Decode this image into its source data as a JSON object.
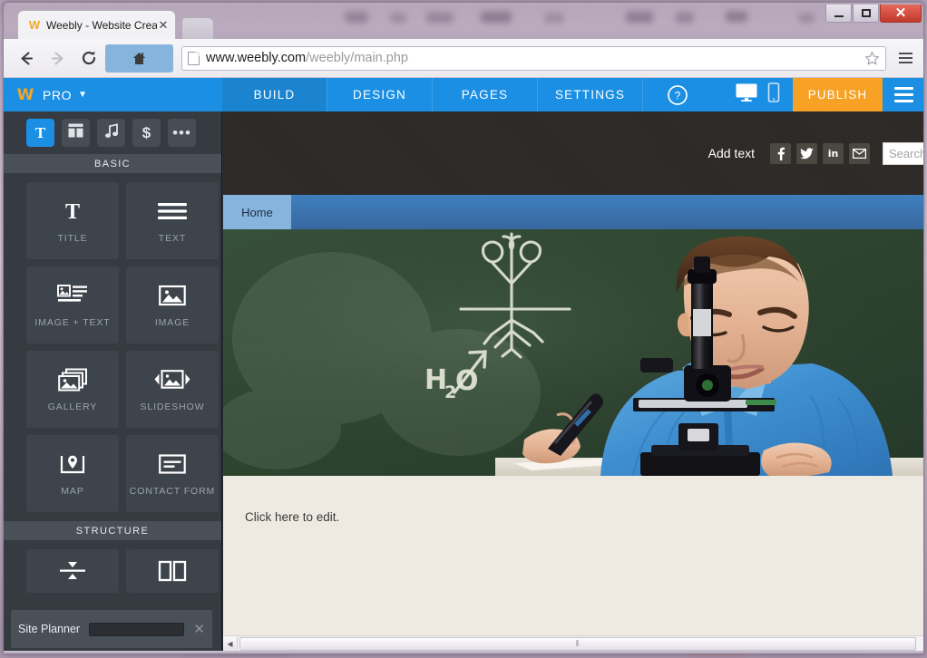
{
  "window": {
    "minimize_label": "Minimize",
    "maximize_label": "Maximize",
    "close_label": "✕"
  },
  "browser": {
    "tab": {
      "favicon": "weebly-w-icon",
      "title": "Weebly - Website Creation",
      "close_label": "✕"
    },
    "new_tab_label": "",
    "toolbar": {
      "back_label": "Back",
      "forward_label": "Forward",
      "reload_label": "Reload",
      "home_label": "Home",
      "url_prefix": "www.weebly.com",
      "url_suffix": "/weebly/main.php",
      "url_full": "www.weebly.com/weebly/main.php",
      "bookmark_label": "Bookmark",
      "menu_label": "Menu"
    }
  },
  "app": {
    "brand": {
      "logo_letter": "W",
      "plan_label": "PRO",
      "caret": "▼"
    },
    "topnav": [
      {
        "label": "BUILD",
        "active": true
      },
      {
        "label": "DESIGN",
        "active": false
      },
      {
        "label": "PAGES",
        "active": false
      },
      {
        "label": "SETTINGS",
        "active": false
      }
    ],
    "help_label": "?",
    "device_desktop_label": "Desktop preview",
    "device_mobile_label": "Mobile preview",
    "publish_label": "PUBLISH",
    "hamburger_label": "More options",
    "accent_blue": "#1b8fe3",
    "publish_orange": "#f7a125"
  },
  "sidebar": {
    "categories": [
      {
        "name": "text-elements",
        "glyph": "T",
        "active": true
      },
      {
        "name": "layout-elements",
        "glyph": "grid",
        "active": false
      },
      {
        "name": "media-elements",
        "glyph": "♪",
        "active": false
      },
      {
        "name": "commerce-elements",
        "glyph": "$",
        "active": false
      },
      {
        "name": "more-elements",
        "glyph": "•••",
        "active": false
      }
    ],
    "basic_header": "BASIC",
    "basic_elements": [
      {
        "label": "TITLE",
        "icon": "title-icon"
      },
      {
        "label": "TEXT",
        "icon": "text-lines-icon"
      },
      {
        "label": "IMAGE + TEXT",
        "icon": "image-text-icon"
      },
      {
        "label": "IMAGE",
        "icon": "image-icon"
      },
      {
        "label": "GALLERY",
        "icon": "gallery-icon"
      },
      {
        "label": "SLIDESHOW",
        "icon": "slideshow-icon"
      },
      {
        "label": "MAP",
        "icon": "map-pin-icon"
      },
      {
        "label": "CONTACT FORM",
        "icon": "contact-form-icon"
      }
    ],
    "structure_header": "STRUCTURE",
    "structure_elements": [
      {
        "label": "",
        "icon": "divider-icon"
      },
      {
        "label": "",
        "icon": "two-columns-icon"
      }
    ],
    "site_planner": {
      "label": "Site Planner",
      "progress_percent": 11,
      "close_label": "✕"
    }
  },
  "preview": {
    "header": {
      "add_text_label": "Add text",
      "social": [
        {
          "name": "facebook-icon",
          "glyph": "f"
        },
        {
          "name": "twitter-icon",
          "glyph": "🐦"
        },
        {
          "name": "linkedin-icon",
          "glyph": "in"
        },
        {
          "name": "email-icon",
          "glyph": "✉"
        }
      ],
      "search_placeholder": "Search"
    },
    "nav": [
      {
        "label": "Home",
        "active": true
      }
    ],
    "hero": {
      "alt": "Boy in blue polo shirt looking into a microscope in front of a green chalkboard",
      "chalk_formula": "H₂O",
      "chalk_drawing": "plant-roots-diagram"
    },
    "content_placeholder": "Click here to edit.",
    "background_color": "#efeae1"
  },
  "scrollbar": {
    "left_arrow": "◀",
    "grip": "⦀"
  }
}
